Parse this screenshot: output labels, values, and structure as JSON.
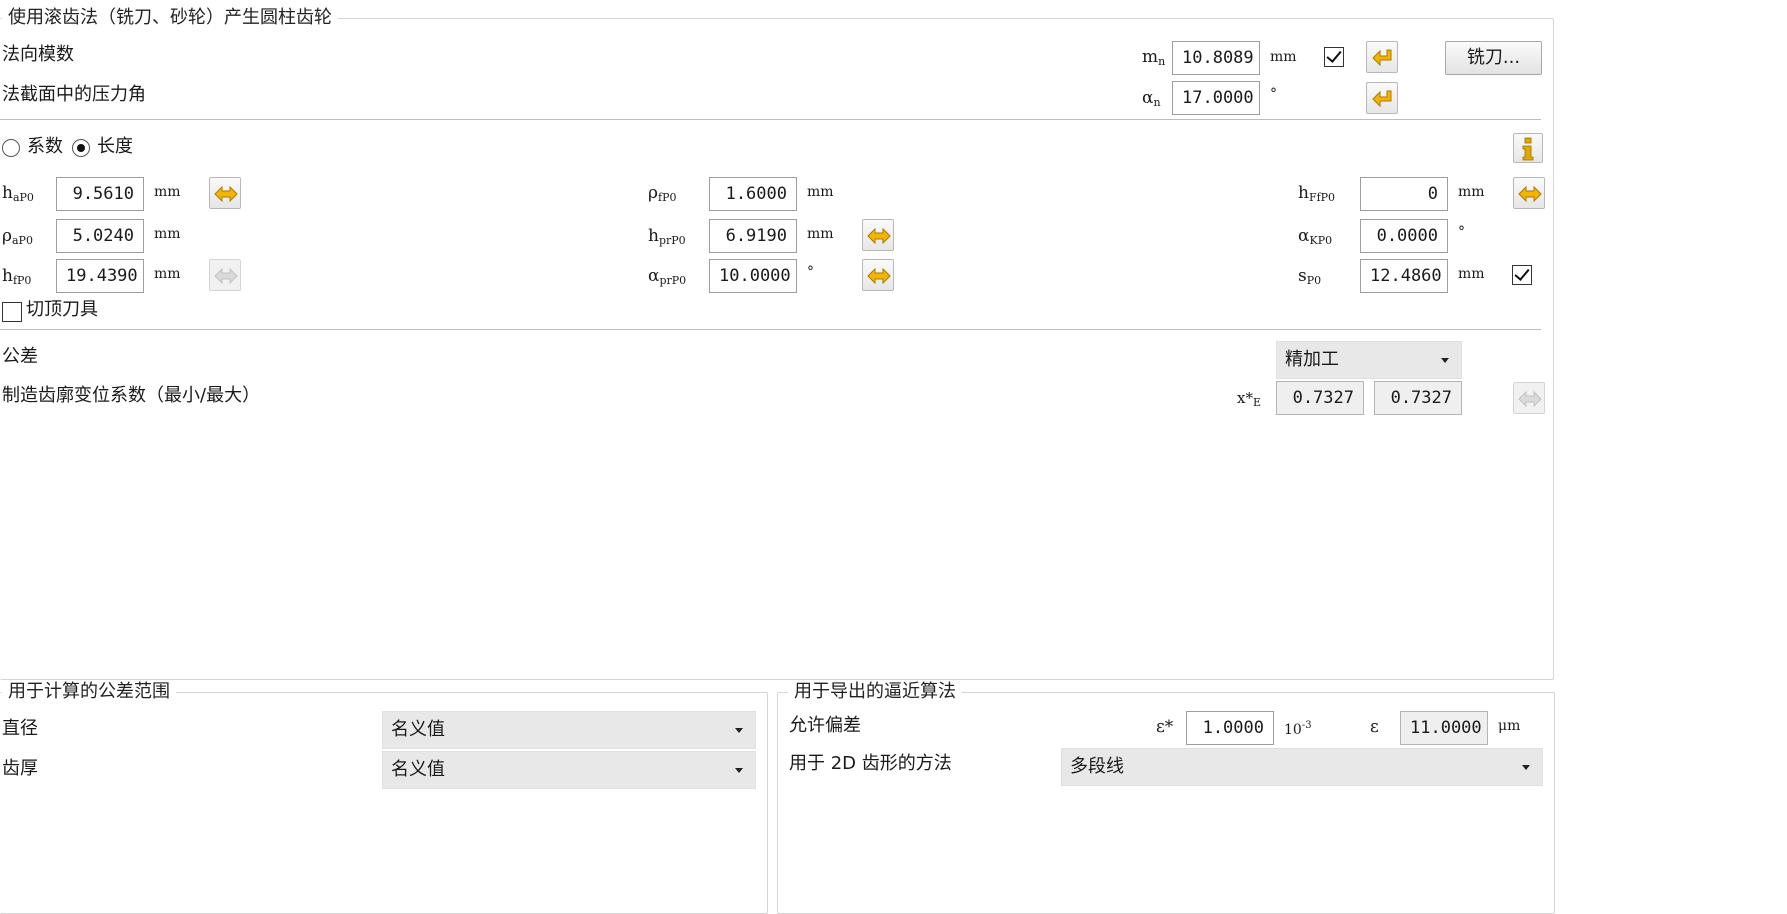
{
  "top_group": {
    "title": "使用滚齿法（铣刀、砂轮）产生圆柱齿轮",
    "normal_module": {
      "label": "法向模数",
      "symbol": "m",
      "sub": "n",
      "value": "10.8089",
      "unit": "mm",
      "checked": true
    },
    "pressure_angle": {
      "label": "法截面中的压力角",
      "symbol": "α",
      "sub": "n",
      "value": "17.0000",
      "unit": "°"
    },
    "cutter_button": "铣刀..."
  },
  "mode": {
    "option1": "系数",
    "option2": "长度",
    "selected": "长度"
  },
  "params": {
    "haP0": {
      "symbol": "h",
      "sub": "aP0",
      "value": "9.5610",
      "unit": "mm"
    },
    "rhoaP0": {
      "symbol": "ρ",
      "sub": "aP0",
      "value": "5.0240",
      "unit": "mm"
    },
    "hfP0": {
      "symbol": "h",
      "sub": "fP0",
      "value": "19.4390",
      "unit": "mm"
    },
    "rhofP0": {
      "symbol": "ρ",
      "sub": "fP0",
      "value": "1.6000",
      "unit": "mm"
    },
    "hprP0": {
      "symbol": "h",
      "sub": "prP0",
      "value": "6.9190",
      "unit": "mm"
    },
    "alphaprP0": {
      "symbol": "α",
      "sub": "prP0",
      "value": "10.0000",
      "unit": "°"
    },
    "hFfP0": {
      "symbol": "h",
      "sub": "FfP0",
      "value": "0",
      "unit": "mm"
    },
    "alphaKP0": {
      "symbol": "α",
      "sub": "KP0",
      "value": "0.0000",
      "unit": "°"
    },
    "sP0": {
      "symbol": "s",
      "sub": "P0",
      "value": "12.4860",
      "unit": "mm",
      "checked": true
    }
  },
  "topping_tool": {
    "label": "切顶刀具",
    "checked": false
  },
  "tolerance": {
    "label": "公差",
    "value": "精加工"
  },
  "profile_shift": {
    "label": "制造齿廓变位系数（最小/最大）",
    "symbol": "x*",
    "sub": "E",
    "min": "0.7327",
    "max": "0.7327"
  },
  "calc_group": {
    "title": "用于计算的公差范围",
    "diameter": {
      "label": "直径",
      "value": "名义值"
    },
    "thickness": {
      "label": "齿厚",
      "value": "名义值"
    }
  },
  "approx_group": {
    "title": "用于导出的逼近算法",
    "deviation": {
      "label": "允许偏差",
      "symbol": "ε*",
      "value": "1.0000",
      "unit_base": "10",
      "unit_exp": "-3",
      "symbol2": "ε",
      "value2": "11.0000",
      "unit2": "μm"
    },
    "method2d": {
      "label": "用于 2D 齿形的方法",
      "value": "多段线"
    }
  },
  "colors": {
    "accent_arrow": "#f2b600",
    "arrow_outline": "#b07800",
    "info_icon": "#e0a800"
  }
}
